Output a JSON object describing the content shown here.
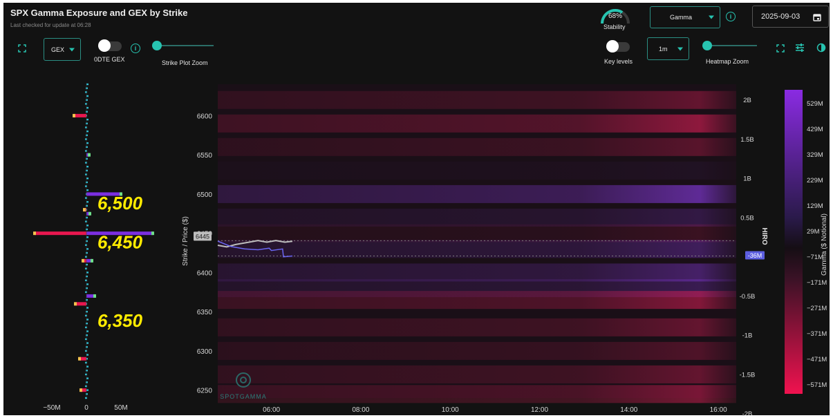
{
  "header": {
    "title": "SPX Gamma Exposure and GEX by Strike",
    "subtitle": "Last checked for update at 06:28"
  },
  "toolbar": {
    "gex_select": "GEX",
    "zero_dte_label": "0DTE GEX",
    "strike_zoom_label": "Strike Plot Zoom",
    "stability_value": "68%",
    "stability_label": "Stability",
    "stability_fraction": 0.68,
    "gamma_select": "Gamma",
    "date": "2025-09-03",
    "key_levels_label": "Key levels",
    "interval_select": "1m",
    "heatmap_zoom_label": "Heatmap Zoom"
  },
  "icons": [
    "expand-icon",
    "caret-down-icon",
    "info-icon",
    "calendar-icon",
    "sliders-icon",
    "contrast-icon"
  ],
  "colors": {
    "accent": "#27c3b0",
    "negative": "#e8174f",
    "positive": "#7b2fe0",
    "price_line": "#bdbdbd",
    "hiro_line": "#6a66f2",
    "annotation": "#ffeb00"
  },
  "chart_data": [
    {
      "type": "bar",
      "title": "",
      "orientation": "horizontal",
      "x_ticks": [
        "−50M",
        "0",
        "50M"
      ],
      "xlim": [
        -80,
        100
      ],
      "annotations": [
        "6,500",
        "6,450",
        "6,350"
      ],
      "series": [
        {
          "name": "",
          "color": "#e8174f",
          "values": [
            {
              "strike": 6600,
              "value": -18
            },
            {
              "strike": 6450,
              "value": -75
            },
            {
              "strike": 6360,
              "value": -16
            },
            {
              "strike": 6290,
              "value": -10
            },
            {
              "strike": 6250,
              "value": -8
            },
            {
              "strike": 6415,
              "value": -5
            },
            {
              "strike": 6480,
              "value": -3
            }
          ]
        },
        {
          "name": "",
          "color": "#7b2fe0",
          "values": [
            {
              "strike": 6500,
              "value": 50
            },
            {
              "strike": 6450,
              "value": 96
            },
            {
              "strike": 6370,
              "value": 12
            },
            {
              "strike": 6415,
              "value": 8
            },
            {
              "strike": 6550,
              "value": 4
            },
            {
              "strike": 6475,
              "value": 5
            }
          ]
        }
      ]
    },
    {
      "type": "heatmap",
      "y_label": "Strike / Price ($)",
      "y_ticks": [
        6250,
        6300,
        6350,
        6400,
        6450,
        6500,
        6550,
        6600
      ],
      "ylim": [
        6240,
        6640
      ],
      "x_ticks": [
        "06:00",
        "08:00",
        "10:00",
        "12:00",
        "14:00",
        "16:00"
      ],
      "xlim_hours": [
        4.8,
        16.4
      ],
      "price_marker": "6445",
      "hiro_marker": "-36M",
      "hiro_label": "HIRO",
      "hiro_ticks": [
        "2B",
        "1.5B",
        "1B",
        "0.5B",
        "0",
        "-0.5B",
        "-1B",
        "-1.5B",
        "-2B"
      ],
      "hiro_lim": [
        -2,
        2
      ],
      "colorbar_label": "Gamma ($ Notional)",
      "colorbar_ticks": [
        "529M",
        "429M",
        "329M",
        "229M",
        "129M",
        "29M",
        "−71M",
        "−171M",
        "−271M",
        "−371M",
        "−471M",
        "−571M"
      ],
      "rows": [
        {
          "strike": 6620,
          "value": -0.35
        },
        {
          "strike": 6590,
          "value": -0.55
        },
        {
          "strike": 6560,
          "value": -0.3
        },
        {
          "strike": 6530,
          "value": 0.05
        },
        {
          "strike": 6500,
          "value": 0.55
        },
        {
          "strike": 6470,
          "value": 0.2
        },
        {
          "strike": 6450,
          "value": -0.15
        },
        {
          "strike": 6430,
          "value": 0.3
        },
        {
          "strike": 6400,
          "value": 0.35
        },
        {
          "strike": 6380,
          "value": 0.25
        },
        {
          "strike": 6365,
          "value": -0.5
        },
        {
          "strike": 6330,
          "value": -0.35
        },
        {
          "strike": 6300,
          "value": -0.25
        },
        {
          "strike": 6270,
          "value": -0.35
        },
        {
          "strike": 6245,
          "value": -0.45
        }
      ],
      "price_series": [
        {
          "t": 4.8,
          "v": 6440
        },
        {
          "t": 5.0,
          "v": 6438
        },
        {
          "t": 5.2,
          "v": 6441
        },
        {
          "t": 5.5,
          "v": 6444
        },
        {
          "t": 5.7,
          "v": 6446
        },
        {
          "t": 5.9,
          "v": 6444
        },
        {
          "t": 6.1,
          "v": 6446
        },
        {
          "t": 6.3,
          "v": 6444
        },
        {
          "t": 6.47,
          "v": 6445
        }
      ],
      "hiro_series": [
        {
          "t": 4.8,
          "v": 0.15
        },
        {
          "t": 5.1,
          "v": 0.08
        },
        {
          "t": 5.4,
          "v": 0.05
        },
        {
          "t": 5.7,
          "v": 0.04
        },
        {
          "t": 5.95,
          "v": 0.06
        },
        {
          "t": 6.0,
          "v": 0.03
        },
        {
          "t": 6.25,
          "v": 0.05
        },
        {
          "t": 6.27,
          "v": -0.05
        },
        {
          "t": 6.47,
          "v": -0.04
        }
      ]
    }
  ],
  "watermark": "SPOTGAMMA"
}
